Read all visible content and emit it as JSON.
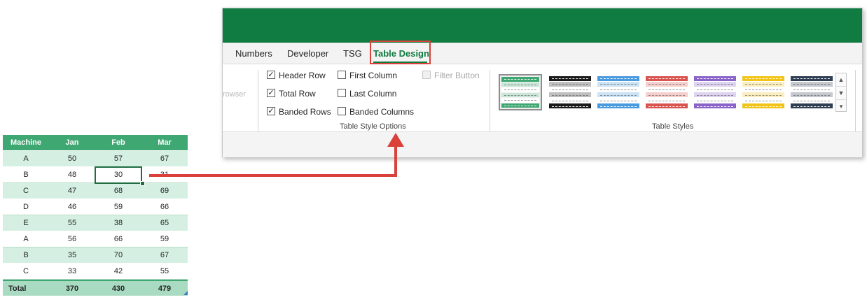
{
  "ribbon": {
    "tabs": [
      "Numbers",
      "Developer",
      "TSG",
      "Table Design"
    ],
    "active_tab": "Table Design",
    "faded_left_text": "rowser",
    "options": {
      "header_row": "Header Row",
      "total_row": "Total Row",
      "banded_rows": "Banded Rows",
      "first_column": "First Column",
      "last_column": "Last Column",
      "banded_columns": "Banded Columns",
      "filter_button": "Filter Button"
    },
    "checked": {
      "header_row": true,
      "total_row": true,
      "banded_rows": true,
      "first_column": false,
      "last_column": false,
      "banded_columns": false,
      "filter_button": false
    },
    "group_table_style_options": "Table Style Options",
    "group_table_styles": "Table Styles",
    "style_swatch_colors": [
      "#3fa772",
      "#1a1a1a",
      "#4a9ae0",
      "#d9534f",
      "#8a63c9",
      "#f2c418",
      "#2f3e52"
    ],
    "scroll_icons": [
      "chevron-up-icon",
      "chevron-down-icon",
      "more-icon"
    ]
  },
  "table": {
    "headers": [
      "Machine",
      "Jan",
      "Feb",
      "Mar"
    ],
    "rows": [
      [
        "A",
        "50",
        "57",
        "67"
      ],
      [
        "B",
        "48",
        "30",
        "31"
      ],
      [
        "C",
        "47",
        "68",
        "69"
      ],
      [
        "D",
        "46",
        "59",
        "66"
      ],
      [
        "E",
        "55",
        "38",
        "65"
      ],
      [
        "A",
        "56",
        "66",
        "59"
      ],
      [
        "B",
        "35",
        "70",
        "67"
      ],
      [
        "C",
        "33",
        "42",
        "55"
      ]
    ],
    "total": [
      "Total",
      "370",
      "430",
      "479"
    ],
    "selected_cell": "30"
  },
  "colors": {
    "excel_green": "#107c41",
    "table_header": "#3fa772",
    "band": "#d5efe2",
    "total_row": "#a9dbc2",
    "annotation_red": "#d9413a"
  }
}
